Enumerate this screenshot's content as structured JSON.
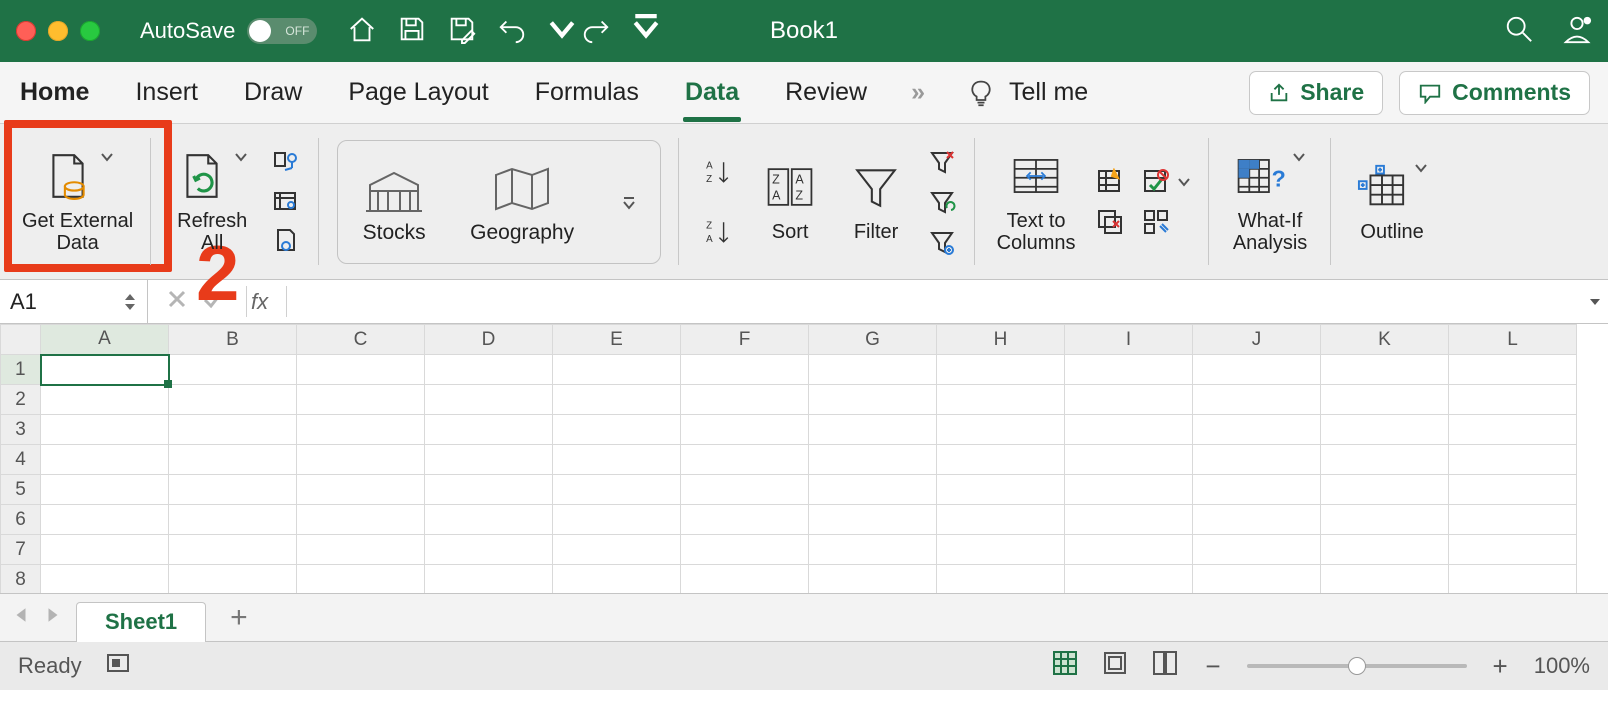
{
  "titlebar": {
    "autosave_label": "AutoSave",
    "autosave_state": "OFF",
    "workbook_title": "Book1"
  },
  "tabs": {
    "items": [
      "Home",
      "Insert",
      "Draw",
      "Page Layout",
      "Formulas",
      "Data",
      "Review"
    ],
    "active_index": 5,
    "tell_me": "Tell me",
    "share": "Share",
    "comments": "Comments"
  },
  "ribbon": {
    "get_external_data": "Get External Data",
    "refresh_all": "Refresh All",
    "stocks": "Stocks",
    "geography": "Geography",
    "sort": "Sort",
    "filter": "Filter",
    "text_to_columns": "Text to Columns",
    "whatif": "What-If Analysis",
    "outline": "Outline"
  },
  "annotation": {
    "step_number": "2"
  },
  "formula_bar": {
    "name_box": "A1",
    "fx": "fx",
    "formula": ""
  },
  "grid": {
    "columns": [
      "A",
      "B",
      "C",
      "D",
      "E",
      "F",
      "G",
      "H",
      "I",
      "J",
      "K",
      "L"
    ],
    "rows": [
      "1",
      "2",
      "3",
      "4",
      "5",
      "6",
      "7",
      "8"
    ],
    "selected_col": 0,
    "selected_row": 0
  },
  "sheets": {
    "active": "Sheet1"
  },
  "status": {
    "ready": "Ready",
    "zoom": "100%"
  }
}
